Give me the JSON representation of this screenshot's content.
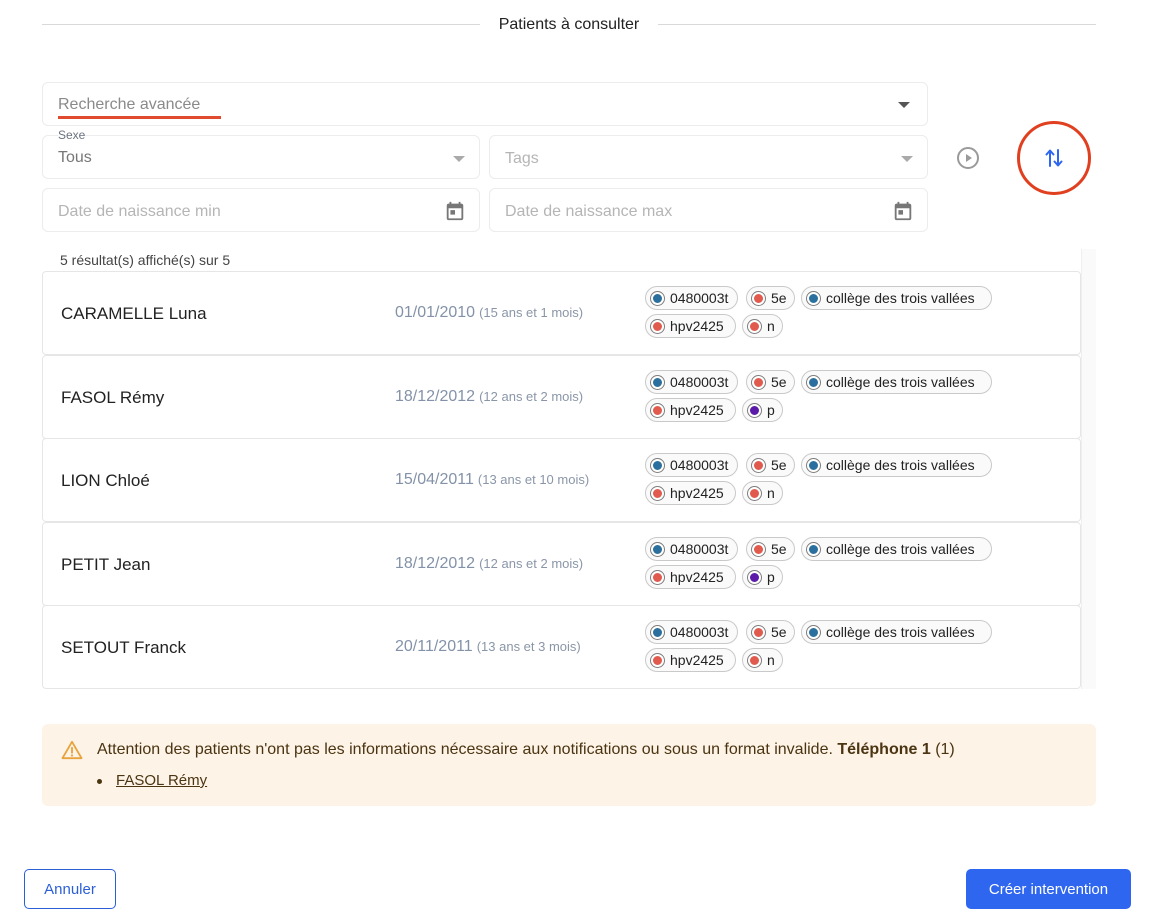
{
  "header": {
    "title": "Patients à consulter"
  },
  "filters": {
    "search_placeholder": "Recherche avancée",
    "sex_label": "Sexe",
    "sex_value": "Tous",
    "tags_placeholder": "Tags",
    "birth_min_placeholder": "Date de naissance min",
    "birth_max_placeholder": "Date de naissance max"
  },
  "results": {
    "count_text": "5 résultat(s) affiché(s) sur 5",
    "rows": [
      {
        "name": "CARAMELLE Luna",
        "date": "01/01/2010",
        "age": "(15 ans et 1 mois)",
        "tags": [
          "0480003t",
          "5e",
          "collège des trois vallées",
          "hpv2425",
          "n"
        ]
      },
      {
        "name": "FASOL Rémy",
        "date": "18/12/2012",
        "age": "(12 ans et 2 mois)",
        "tags": [
          "0480003t",
          "5e",
          "collège des trois vallées",
          "hpv2425",
          "p"
        ]
      },
      {
        "name": "LION Chloé",
        "date": "15/04/2011",
        "age": "(13 ans et 10 mois)",
        "tags": [
          "0480003t",
          "5e",
          "collège des trois vallées",
          "hpv2425",
          "n"
        ]
      },
      {
        "name": "PETIT Jean",
        "date": "18/12/2012",
        "age": "(12 ans et 2 mois)",
        "tags": [
          "0480003t",
          "5e",
          "collège des trois vallées",
          "hpv2425",
          "p"
        ]
      },
      {
        "name": "SETOUT Franck",
        "date": "20/11/2011",
        "age": "(13 ans et 3 mois)",
        "tags": [
          "0480003t",
          "5e",
          "collège des trois vallées",
          "hpv2425",
          "n"
        ]
      }
    ]
  },
  "tag_colors": {
    "0480003t": "#2b6f9e",
    "5e": "#e05a4e",
    "collège des trois vallées": "#2b6f9e",
    "hpv2425": "#e05a4e",
    "n": "#e05a4e",
    "p": "#5b1aa8"
  },
  "alert": {
    "message": "Attention des patients n'ont pas les informations nécessaire aux notifications ou sous un format invalide.",
    "field": "Téléphone 1",
    "count": "(1)",
    "patients": [
      "FASOL Rémy"
    ]
  },
  "footer": {
    "cancel_label": "Annuler",
    "create_label": "Créer intervention"
  },
  "colors": {
    "primary": "#2f66f0",
    "highlight": "#e0401f",
    "warning_bg": "#fdf3e6"
  }
}
